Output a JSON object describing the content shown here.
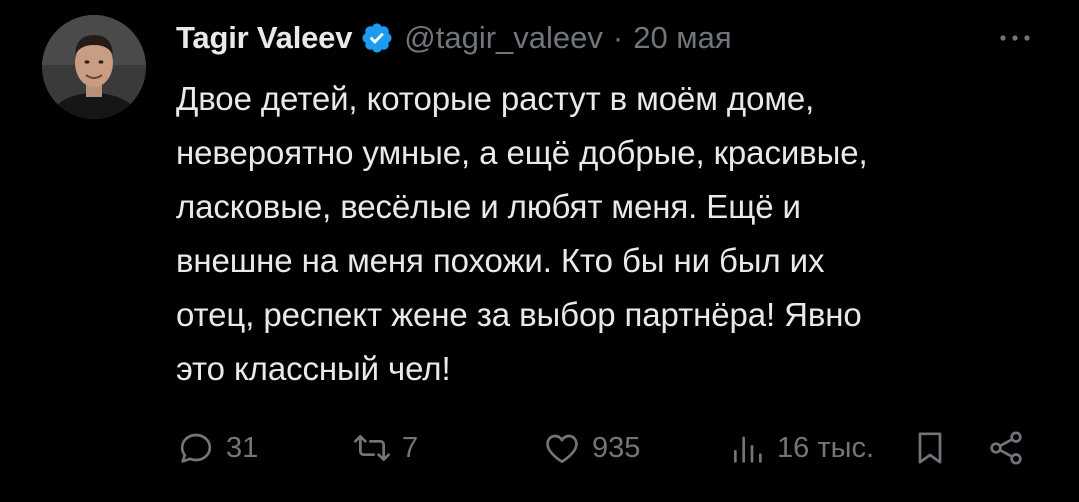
{
  "tweet": {
    "author_name": "Tagir Valeev",
    "handle": "@tagir_valeev",
    "separator": "·",
    "date": "20 мая",
    "more_label": "···",
    "text": "Двое детей, которые растут в моём доме,\nневероятно умные, а ещё добрые, красивые,\nласковые, весёлые и любят меня. Ещё и\nвнешне на меня похожи. Кто бы ни был их\nотец, респект жене за выбор партнёра! Явно\nэто классный чел!",
    "replies": "31",
    "reposts": "7",
    "likes": "935",
    "views": "16 тыс."
  },
  "icons": {
    "verified": "verified-badge-icon",
    "more": "more-icon",
    "reply": "reply-icon",
    "repost": "repost-icon",
    "like": "like-icon",
    "views": "views-icon",
    "bookmark": "bookmark-icon",
    "share": "share-icon"
  },
  "colors": {
    "background": "#000000",
    "text": "#e7e9ea",
    "secondary": "#71767b",
    "verified": "#1d9bf0"
  }
}
